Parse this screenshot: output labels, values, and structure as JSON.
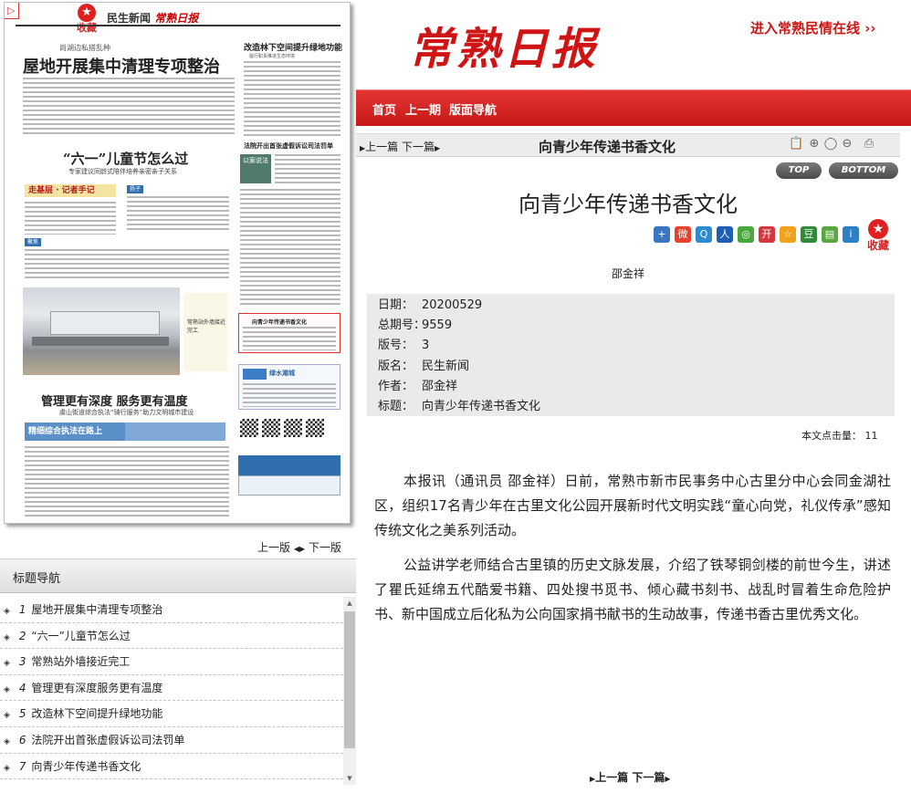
{
  "paper": {
    "fav_label": "收藏",
    "masthead_section": "民生新闻",
    "masthead_brand": "常熟日报",
    "kicker": "尚湖边私搭乱种",
    "headline": "屋地开展集中清理专项整治",
    "headline_right": "改造林下空间提升绿地功能",
    "sub_right": "履行职责推进生态环境",
    "h2": "“六一”儿童节怎么过",
    "h2_sub": "专家建议同龄式陪伴培养亲密亲子关系",
    "reporter_banner": "走基层 · 记者手记",
    "h_right2": "法院开出首张虚假诉讼司法罚单",
    "photo_caption": "以案说法",
    "tag1": "扬子",
    "tag2": "聚焦",
    "station_caption": "常熟站外墙接近完工",
    "highlight_title": "向青少年传递书香文化",
    "h3": "管理更有深度 服务更有温度",
    "h3_sub": "虞山街道综合执法“骑行服务”助力文明城市建设",
    "blue_strip": "精细综合执法在路上",
    "ad_title": "绿水潮城"
  },
  "page_nav": {
    "prev": "上一版",
    "next": "下一版"
  },
  "title_nav": {
    "header": "标题导航",
    "items": [
      {
        "num": "1",
        "title": "屋地开展集中清理专项整治"
      },
      {
        "num": "2",
        "title": "“六一”儿童节怎么过"
      },
      {
        "num": "3",
        "title": "常熟站外墙接近完工"
      },
      {
        "num": "4",
        "title": "管理更有深度服务更有温度"
      },
      {
        "num": "5",
        "title": "改造林下空间提升绿地功能"
      },
      {
        "num": "6",
        "title": "法院开出首张虚假诉讼司法罚单"
      },
      {
        "num": "7",
        "title": "向青少年传递书香文化"
      }
    ]
  },
  "header": {
    "logo": "常熟日报",
    "portal_link": "进入常熟民情在线 ››"
  },
  "nav": {
    "home": "首页",
    "prev_issue": "上一期",
    "layout_nav": "版面导航"
  },
  "article_bar": {
    "prev": "上一篇",
    "next": "下一篇",
    "title": "向青少年传递书香文化"
  },
  "buttons": {
    "top": "TOP",
    "bottom": "BOTTOM"
  },
  "article": {
    "title": "向青少年传递书香文化",
    "byline": "邵金祥",
    "fav_label": "收藏",
    "meta": [
      {
        "key": "日期：",
        "value": "20200529"
      },
      {
        "key": "总期号：",
        "value": "9559"
      },
      {
        "key": "版号：",
        "value": "3"
      },
      {
        "key": "版名：",
        "value": "民生新闻"
      },
      {
        "key": "作者：",
        "value": "邵金祥"
      },
      {
        "key": "标题：",
        "value": "向青少年传递书香文化"
      }
    ],
    "clicks_label": "本文点击量：",
    "clicks_value": "11",
    "paragraphs": [
      "本报讯（通讯员 邵金祥）日前，常熟市新市民事务中心古里分中心会同金湖社区，组织17名青少年在古里文化公园开展新时代文明实践“童心向党，礼仪传承”感知传统文化之美系列活动。",
      "公益讲学老师结合古里镇的历史文脉发展，介绍了铁琴铜剑楼的前世今生，讲述了瞿氏延绵五代酷爱书籍、四处搜书觅书、倾心藏书刻书、战乱时冒着生命危险护书、新中国成立后化私为公向国家捐书献书的生动故事，传递书香古里优秀文化。"
    ]
  },
  "footer_nav": {
    "prev": "上一篇",
    "next": "下一篇"
  },
  "share_icons": [
    "plus-icon",
    "weibo-icon",
    "qzone-icon",
    "renren-icon",
    "wechat-icon",
    "kaixin-icon",
    "star-icon",
    "douban-icon",
    "chat-icon",
    "info-icon"
  ],
  "colors": {
    "brand_red": "#d01414",
    "nav_red": "#c71818",
    "meta_bg": "#eaeaea"
  }
}
